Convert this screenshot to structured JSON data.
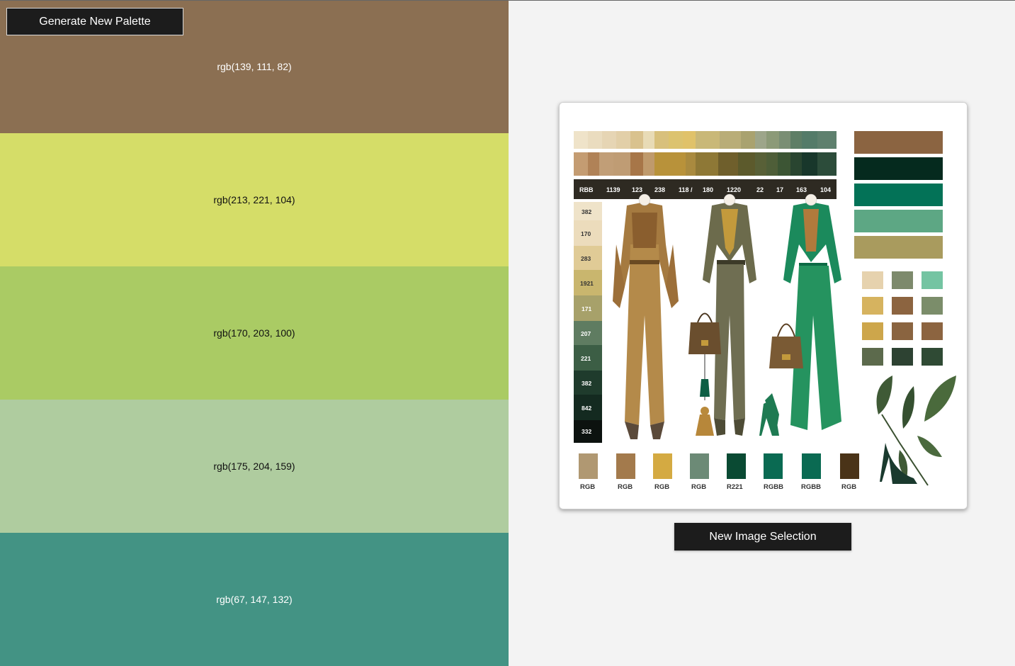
{
  "palette": {
    "generate_label": "Generate New Palette",
    "swatches": [
      {
        "label": "rgb(139, 111, 82)",
        "color": "#8b6f52",
        "text_color": "#ffffff"
      },
      {
        "label": "rgb(213, 221, 104)",
        "color": "#d5dd68",
        "text_color": "#111111"
      },
      {
        "label": "rgb(170, 203, 100)",
        "color": "#aacb64",
        "text_color": "#111111"
      },
      {
        "label": "rgb(175, 204, 159)",
        "color": "#afcc9f",
        "text_color": "#111111"
      },
      {
        "label": "rgb(67, 147, 132)",
        "color": "#439384",
        "text_color": "#ffffff"
      }
    ]
  },
  "image_panel": {
    "new_image_label": "New Image Selection",
    "mood_board": {
      "header_labels": [
        "RBB",
        "1139",
        "123",
        "238",
        "118 /",
        "180",
        "1220",
        "22",
        "17",
        "163",
        "104"
      ],
      "side_labels": [
        "382",
        "170",
        "283",
        "1921",
        "171",
        "207",
        "221",
        "382",
        "842",
        "332"
      ],
      "bottom_labels": [
        "RGB",
        "RGB",
        "RGB",
        "RGB",
        "R221",
        "RGBB",
        "RGBB",
        "RGB"
      ]
    }
  }
}
